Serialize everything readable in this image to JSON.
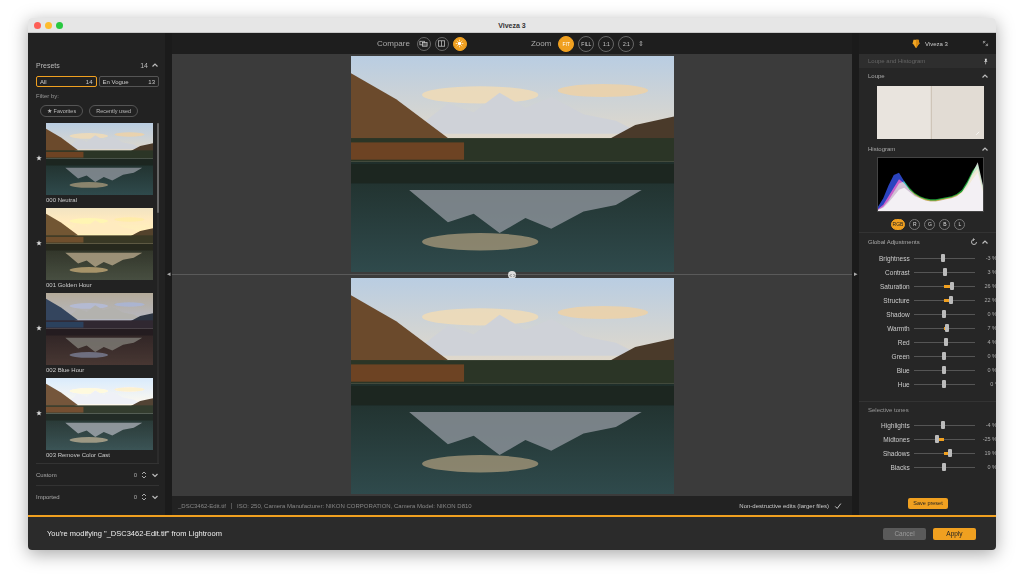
{
  "window": {
    "title": "Viveza 3"
  },
  "toolbar": {
    "compare_label": "Compare",
    "compare_buttons": [
      {
        "kind": "side-by-side",
        "selected": false
      },
      {
        "kind": "split",
        "selected": false
      },
      {
        "kind": "preview",
        "selected": true
      }
    ],
    "zoom_label": "Zoom",
    "zoom_buttons": [
      {
        "label": "FIT",
        "selected": true
      },
      {
        "label": "FILL",
        "selected": false
      },
      {
        "label": "1:1",
        "selected": false
      },
      {
        "label": "2:1",
        "selected": false
      }
    ],
    "zoom_stepper": "⇕"
  },
  "presets_panel": {
    "title": "Presets",
    "count": "14",
    "filter_tabs": [
      {
        "label": "All",
        "count": "14",
        "selected": true
      },
      {
        "label": "En Vogue",
        "count": "13",
        "selected": false
      }
    ],
    "filter_label": "Filter by:",
    "filter_buttons": [
      "★ Favorites",
      "Recently used"
    ],
    "presets": [
      {
        "name": "000 Neutral",
        "favorite": true
      },
      {
        "name": "001 Golden Hour",
        "favorite": true
      },
      {
        "name": "002 Blue Hour",
        "favorite": true
      },
      {
        "name": "003 Remove Color Cast",
        "favorite": true
      }
    ],
    "sections": [
      {
        "label": "Custom",
        "count": "0"
      },
      {
        "label": "Imported",
        "count": "0"
      }
    ]
  },
  "collapse": {
    "left": "◂",
    "right": "▸"
  },
  "preview": {
    "file": "_DSC3462-Edit.tif",
    "meta": "ISO: 250, Camera Manufacturer: NIKON CORPORATION, Camera Model: NIKON D810",
    "option": {
      "label": "Non-destructive edits (larger files)",
      "checked": true
    }
  },
  "right_panel": {
    "title": "Viveza 3",
    "group": "Loupe and Histogram",
    "loupe_title": "Loupe",
    "histogram": {
      "title": "Histogram",
      "series": [
        {
          "name": "blue",
          "color": "#3a5bff",
          "values": [
            4,
            12,
            24,
            34,
            36,
            28,
            20,
            15,
            12,
            10,
            9,
            9,
            10,
            11,
            12,
            14,
            17,
            22,
            30,
            36,
            18
          ]
        },
        {
          "name": "green",
          "color": "#2bd14a",
          "values": [
            1,
            4,
            10,
            18,
            26,
            28,
            22,
            17,
            14,
            12,
            11,
            11,
            12,
            13,
            14,
            16,
            20,
            28,
            38,
            44,
            22
          ]
        },
        {
          "name": "red",
          "color": "#ff3535",
          "values": [
            2,
            6,
            14,
            22,
            30,
            26,
            20,
            16,
            13,
            11,
            10,
            10,
            11,
            12,
            13,
            15,
            18,
            24,
            34,
            40,
            20
          ]
        },
        {
          "name": "luminance",
          "color": "#ffffff",
          "values": [
            1,
            3,
            8,
            14,
            20,
            22,
            18,
            14,
            12,
            10,
            9,
            9,
            10,
            11,
            12,
            14,
            18,
            26,
            36,
            46,
            24
          ]
        }
      ],
      "channels": [
        {
          "label": "RGB",
          "selected": true
        },
        {
          "label": "R",
          "selected": false
        },
        {
          "label": "G",
          "selected": false
        },
        {
          "label": "B",
          "selected": false
        },
        {
          "label": "L",
          "selected": false
        }
      ]
    },
    "global": {
      "title": "Global Adjustments",
      "sliders": [
        {
          "label": "Brightness",
          "value": "-3 %",
          "level": 0.485
        },
        {
          "label": "Contrast",
          "value": "3 %",
          "level": 0.515
        },
        {
          "label": "Saturation",
          "value": "26 %",
          "level": 0.63
        },
        {
          "label": "Structure",
          "value": "22 %",
          "level": 0.61
        },
        {
          "label": "Shadow",
          "value": "0 %",
          "level": 0.5
        },
        {
          "label": "Warmth",
          "value": "7 %",
          "level": 0.535
        },
        {
          "label": "Red",
          "value": "4 %",
          "level": 0.52
        },
        {
          "label": "Green",
          "value": "0 %",
          "level": 0.5
        },
        {
          "label": "Blue",
          "value": "0 %",
          "level": 0.5
        },
        {
          "label": "Hue",
          "value": "0 °",
          "level": 0.5
        }
      ]
    },
    "selective": {
      "title": "Selective tones",
      "sliders": [
        {
          "label": "Highlights",
          "value": "-4 %",
          "level": 0.48
        },
        {
          "label": "Midtones",
          "value": "-25 %",
          "level": 0.375
        },
        {
          "label": "Shadows",
          "value": "19 %",
          "level": 0.595
        },
        {
          "label": "Blacks",
          "value": "0 %",
          "level": 0.5
        }
      ]
    },
    "save_button": "Save preset"
  },
  "footer": {
    "message": "You're modifying \"_DSC3462-Edit.tif\" from Lightroom",
    "buttons": [
      {
        "label": "Cancel",
        "primary": false
      },
      {
        "label": "Apply",
        "primary": true
      }
    ]
  }
}
